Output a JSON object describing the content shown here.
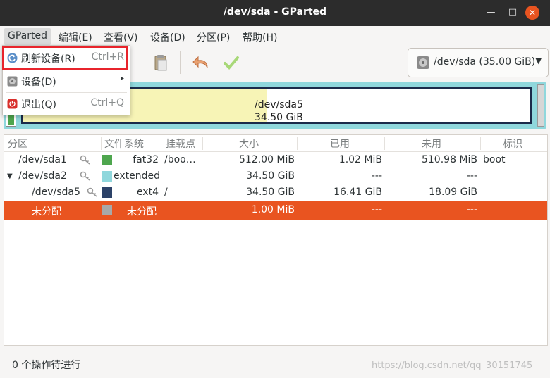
{
  "window": {
    "title": "/dev/sda - GParted",
    "controls": {
      "minimize": "—",
      "maximize": "□",
      "close": "✕"
    }
  },
  "menubar": [
    {
      "label": "GParted"
    },
    {
      "label": "编辑(E)"
    },
    {
      "label": "查看(V)"
    },
    {
      "label": "设备(D)"
    },
    {
      "label": "分区(P)"
    },
    {
      "label": "帮助(H)"
    }
  ],
  "toolbar": {
    "icons": [
      "paste-icon",
      "undo-icon",
      "apply-icon"
    ]
  },
  "device_selector": {
    "label": "/dev/sda (35.00 GiB)",
    "icon": "disk-icon"
  },
  "disk_map": {
    "name": "/dev/sda5",
    "size": "34.50 GiB",
    "colors": {
      "fat32": "#4ea64e",
      "extended": "#8fd7dc",
      "ext4": "#1a2a4a",
      "used": "#f7f4b6",
      "unallocated": "#d6d6d6"
    }
  },
  "table": {
    "headers": [
      "分区",
      "文件系统",
      "挂载点",
      "大小",
      "已用",
      "未用",
      "标识"
    ],
    "rows": [
      {
        "partition": "/dev/sda1",
        "fs": "fat32",
        "fs_color": "#4ea64e",
        "mount": "/boo…",
        "size": "512.00 MiB",
        "used": "1.02 MiB",
        "unused": "510.98 MiB",
        "flags": "boot"
      },
      {
        "partition": "/dev/sda2",
        "fs": "extended",
        "fs_color": "#8fd7dc",
        "mount": "",
        "size": "34.50 GiB",
        "used": "---",
        "unused": "---",
        "flags": ""
      },
      {
        "partition": "/dev/sda5",
        "fs": "ext4",
        "fs_color": "#2c4268",
        "mount": "/",
        "size": "34.50 GiB",
        "used": "16.41 GiB",
        "unused": "18.09 GiB",
        "flags": ""
      },
      {
        "partition": "未分配",
        "fs": "未分配",
        "fs_color": "#a8a8a8",
        "mount": "",
        "size": "1.00 MiB",
        "used": "---",
        "unused": "---",
        "flags": ""
      }
    ]
  },
  "dropdown_menu": {
    "items": [
      {
        "label": "刷新设备(R)",
        "accel": "Ctrl+R",
        "icon": "refresh-icon"
      },
      {
        "label": "设备(D)",
        "submenu": "▸",
        "icon": "disk-icon"
      },
      {
        "label": "退出(Q)",
        "accel": "Ctrl+Q",
        "icon": "quit-icon"
      }
    ]
  },
  "status": {
    "text": "0 个操作待进行"
  },
  "watermark": "https://blog.csdn.net/qq_30151745",
  "accent_color": "#e95420"
}
